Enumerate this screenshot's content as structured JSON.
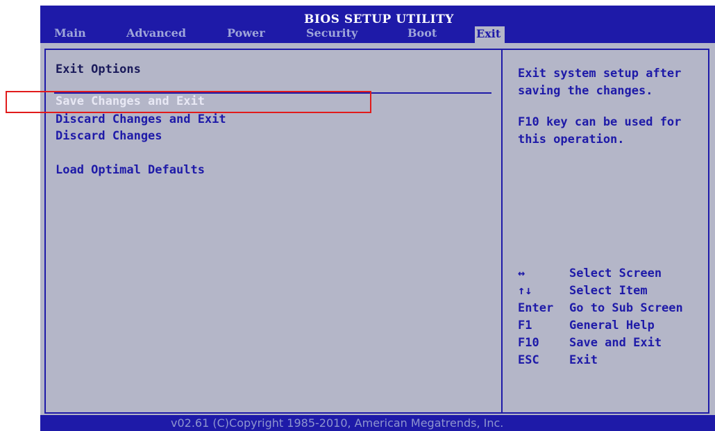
{
  "app_title": "BIOS SETUP UTILITY",
  "tabs": [
    {
      "label": "Main"
    },
    {
      "label": "Advanced"
    },
    {
      "label": "Power"
    },
    {
      "label": "Security"
    },
    {
      "label": "Boot"
    },
    {
      "label": "Exit"
    }
  ],
  "section_title": "Exit Options",
  "menu_items": [
    {
      "label": "Save Changes and Exit"
    },
    {
      "label": "Discard Changes and Exit"
    },
    {
      "label": "Discard Changes"
    },
    {
      "label": "Load Optimal Defaults"
    }
  ],
  "help": {
    "line1": "Exit system setup after saving the changes.",
    "line2": "F10 key can be used for this operation."
  },
  "key_legend": [
    {
      "key": "↔",
      "action": "Select Screen"
    },
    {
      "key": "↑↓",
      "action": "Select Item"
    },
    {
      "key": "Enter",
      "action": "Go to Sub Screen"
    },
    {
      "key": "F1",
      "action": "General Help"
    },
    {
      "key": "F10",
      "action": "Save and Exit"
    },
    {
      "key": "ESC",
      "action": "Exit"
    }
  ],
  "footer": "v02.61 (C)Copyright 1985-2010, American Megatrends, Inc.",
  "colors": {
    "accent": "#1e1aa8",
    "background": "#b4b6c8",
    "highlight_box": "#e11b1b"
  }
}
